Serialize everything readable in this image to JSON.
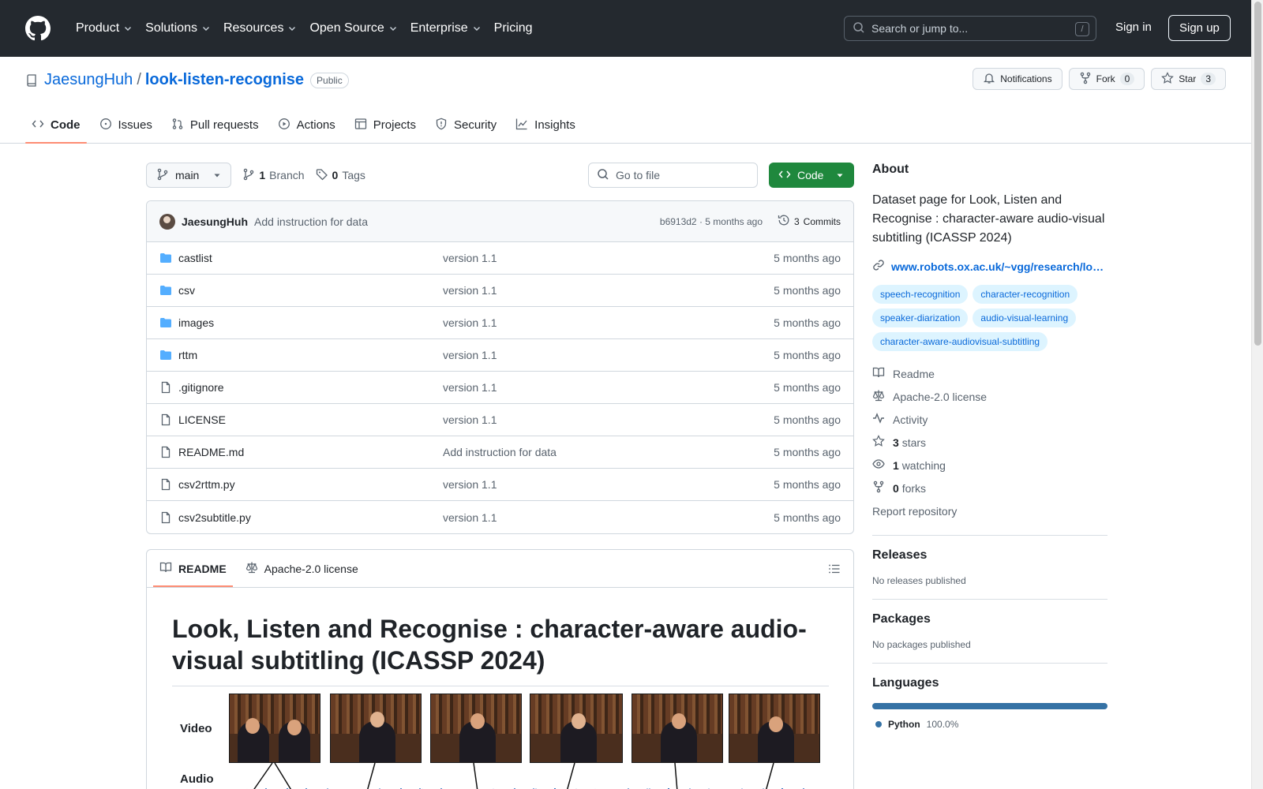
{
  "header": {
    "nav": [
      {
        "label": "Product",
        "has_menu": true
      },
      {
        "label": "Solutions",
        "has_menu": true
      },
      {
        "label": "Resources",
        "has_menu": true
      },
      {
        "label": "Open Source",
        "has_menu": true
      },
      {
        "label": "Enterprise",
        "has_menu": true
      },
      {
        "label": "Pricing",
        "has_menu": false
      }
    ],
    "search_placeholder": "Search or jump to...",
    "search_shortcut": "/",
    "signin": "Sign in",
    "signup": "Sign up"
  },
  "repo": {
    "owner": "JaesungHuh",
    "name": "look-listen-recognise",
    "visibility": "Public",
    "notifications": "Notifications",
    "fork_label": "Fork",
    "fork_count": "0",
    "star_label": "Star",
    "star_count": "3",
    "tabs": [
      {
        "label": "Code",
        "icon": "code-icon",
        "active": true
      },
      {
        "label": "Issues",
        "icon": "issue-icon",
        "active": false
      },
      {
        "label": "Pull requests",
        "icon": "pull-request-icon",
        "active": false
      },
      {
        "label": "Actions",
        "icon": "play-icon",
        "active": false
      },
      {
        "label": "Projects",
        "icon": "table-icon",
        "active": false
      },
      {
        "label": "Security",
        "icon": "shield-icon",
        "active": false
      },
      {
        "label": "Insights",
        "icon": "graph-icon",
        "active": false
      }
    ]
  },
  "toolbar": {
    "branch": "main",
    "branch_count": "1",
    "branch_label": "Branch",
    "tag_count": "0",
    "tag_label": "Tags",
    "goto_placeholder": "Go to file",
    "code_button": "Code"
  },
  "commit": {
    "author": "JaesungHuh",
    "message": "Add instruction for data",
    "sha": "b6913d2",
    "time": "5 months ago",
    "commits_count": "3",
    "commits_label": "Commits"
  },
  "files": [
    {
      "name": "castlist",
      "type": "dir",
      "message": "version 1.1",
      "date": "5 months ago"
    },
    {
      "name": "csv",
      "type": "dir",
      "message": "version 1.1",
      "date": "5 months ago"
    },
    {
      "name": "images",
      "type": "dir",
      "message": "version 1.1",
      "date": "5 months ago"
    },
    {
      "name": "rttm",
      "type": "dir",
      "message": "version 1.1",
      "date": "5 months ago"
    },
    {
      "name": ".gitignore",
      "type": "file",
      "message": "version 1.1",
      "date": "5 months ago"
    },
    {
      "name": "LICENSE",
      "type": "file",
      "message": "version 1.1",
      "date": "5 months ago"
    },
    {
      "name": "README.md",
      "type": "file",
      "message": "Add instruction for data",
      "date": "5 months ago"
    },
    {
      "name": "csv2rttm.py",
      "type": "file",
      "message": "version 1.1",
      "date": "5 months ago"
    },
    {
      "name": "csv2subtitle.py",
      "type": "file",
      "message": "version 1.1",
      "date": "5 months ago"
    }
  ],
  "readme": {
    "tab_readme": "README",
    "tab_license": "Apache-2.0 license",
    "title": "Look, Listen and Recognise : character-aware audio-visual subtitling (ICASSP 2024)",
    "figure_video_label": "Video",
    "figure_audio_label": "Audio"
  },
  "sidebar": {
    "about_heading": "About",
    "description": "Dataset page for Look, Listen and Recognise : character-aware audio-visual subtitling (ICASSP 2024)",
    "link": "www.robots.ox.ac.uk/~vgg/research/lo…",
    "topics": [
      "speech-recognition",
      "character-recognition",
      "speaker-diarization",
      "audio-visual-learning",
      "character-aware-audiovisual-subtitling"
    ],
    "readme": "Readme",
    "license": "Apache-2.0 license",
    "activity": "Activity",
    "stars_count": "3",
    "stars_label": "stars",
    "watching_count": "1",
    "watching_label": "watching",
    "forks_count": "0",
    "forks_label": "forks",
    "report": "Report repository",
    "releases_heading": "Releases",
    "releases_text": "No releases published",
    "packages_heading": "Packages",
    "packages_text": "No packages published",
    "languages_heading": "Languages",
    "language_name": "Python",
    "language_percent": "100.0%",
    "language_color": "#3572A5"
  },
  "colors": {
    "header_bg": "#24292f",
    "link": "#0969da",
    "primary_button": "#1f883d",
    "active_tab_underline": "#fd8c73",
    "folder": "#54aeff"
  }
}
